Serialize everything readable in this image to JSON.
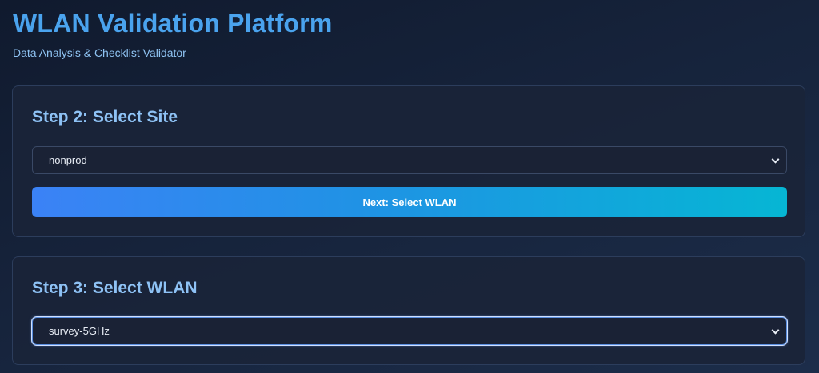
{
  "header": {
    "title": "WLAN Validation Platform",
    "subtitle": "Data Analysis & Checklist Validator"
  },
  "site_step": {
    "title": "Step 2: Select Site",
    "select_value": "nonprod",
    "button_label": "Next: Select WLAN"
  },
  "wlan_step": {
    "title": "Step 3: Select WLAN",
    "select_value": "survey-5GHz"
  },
  "colors": {
    "title": "#4aa3ee",
    "subtitle": "#8fc3f2",
    "card_title": "#8ec2f5",
    "button_gradient_start": "#3b82f6",
    "button_gradient_end": "#06b6d4"
  }
}
